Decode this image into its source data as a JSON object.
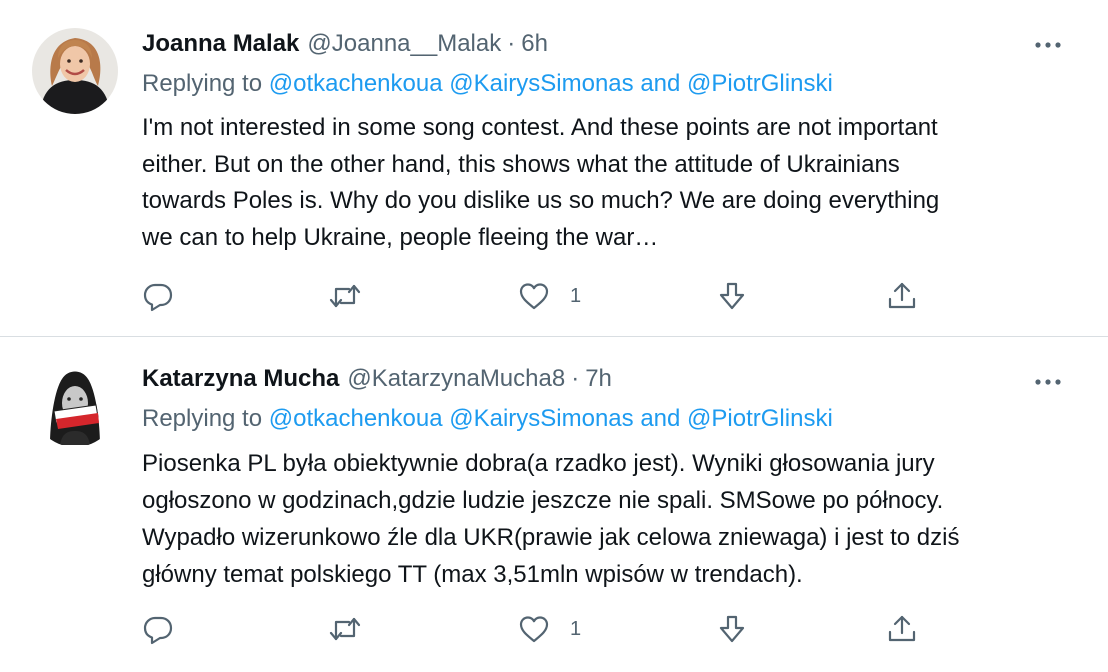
{
  "colors": {
    "link": "#1d9bf0",
    "secondary_text": "#536471",
    "primary_text": "#0f1419",
    "divider": "#d9dee2"
  },
  "tweets": [
    {
      "display_name": "Joanna Malak",
      "handle": "@Joanna__Malak",
      "separator": "·",
      "time": "6h",
      "replying_to_label": "Replying to",
      "mention_1": "@otkachenkoua",
      "mention_2": "@KairysSimonas",
      "joiner": "and",
      "mention_3": "@PiotrGlinski",
      "text_lines": [
        "I'm not interested in some song contest. And these points are not important",
        "either. But on the other hand, this  shows what the attitude of Ukrainians",
        "towards Poles is. Why do you dislike us so much? We are doing everything",
        "we can to help Ukraine, people fleeing the war…"
      ],
      "like_count": "1",
      "icons": [
        "reply-icon",
        "retweet-icon",
        "like-icon",
        "download-icon",
        "share-icon",
        "more-icon"
      ]
    },
    {
      "display_name": "Katarzyna Mucha",
      "handle": "@KatarzynaMucha8",
      "separator": "·",
      "time": "7h",
      "replying_to_label": "Replying to",
      "mention_1": "@otkachenkoua",
      "mention_2": "@KairysSimonas",
      "joiner": "and",
      "mention_3": "@PiotrGlinski",
      "text_lines": [
        "Piosenka PL była obiektywnie dobra(a rzadko jest). Wyniki głosowania jury",
        "ogłoszono w godzinach,gdzie ludzie jeszcze nie spali. SMSowe po północy.",
        "Wypadło wizerunkowo źle dla UKR(prawie jak celowa zniewaga) i jest to dziś",
        "główny temat polskiego TT (max 3,51mln wpisów w trendach)."
      ],
      "like_count": "1",
      "icons": [
        "reply-icon",
        "retweet-icon",
        "like-icon",
        "download-icon",
        "share-icon",
        "more-icon"
      ]
    }
  ]
}
